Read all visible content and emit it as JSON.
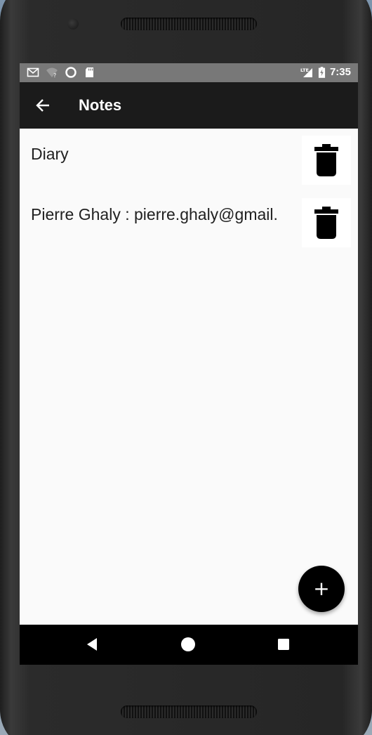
{
  "status_bar": {
    "time": "7:35",
    "left_icons": [
      "gmail-icon",
      "wifi-icon",
      "sync-circle-icon",
      "sd-card-icon"
    ],
    "right_icons": [
      "lte-signal-icon",
      "battery-charging-icon"
    ],
    "lte_label": "LTE"
  },
  "app_bar": {
    "title": "Notes",
    "back_icon": "arrow-back-icon"
  },
  "notes": [
    {
      "text": "Diary",
      "delete_icon": "trash-icon"
    },
    {
      "text": "Pierre Ghaly : pierre.ghaly@gmail.",
      "delete_icon": "trash-icon"
    }
  ],
  "fab": {
    "label": "+"
  },
  "nav_bar": {
    "buttons": [
      "back-triangle-icon",
      "home-circle-icon",
      "recents-square-icon"
    ]
  },
  "colors": {
    "status_bar": "#787878",
    "app_bar": "#1b1b1b",
    "content_bg": "#fafafa",
    "fab": "#000000",
    "nav_bar": "#000000"
  }
}
